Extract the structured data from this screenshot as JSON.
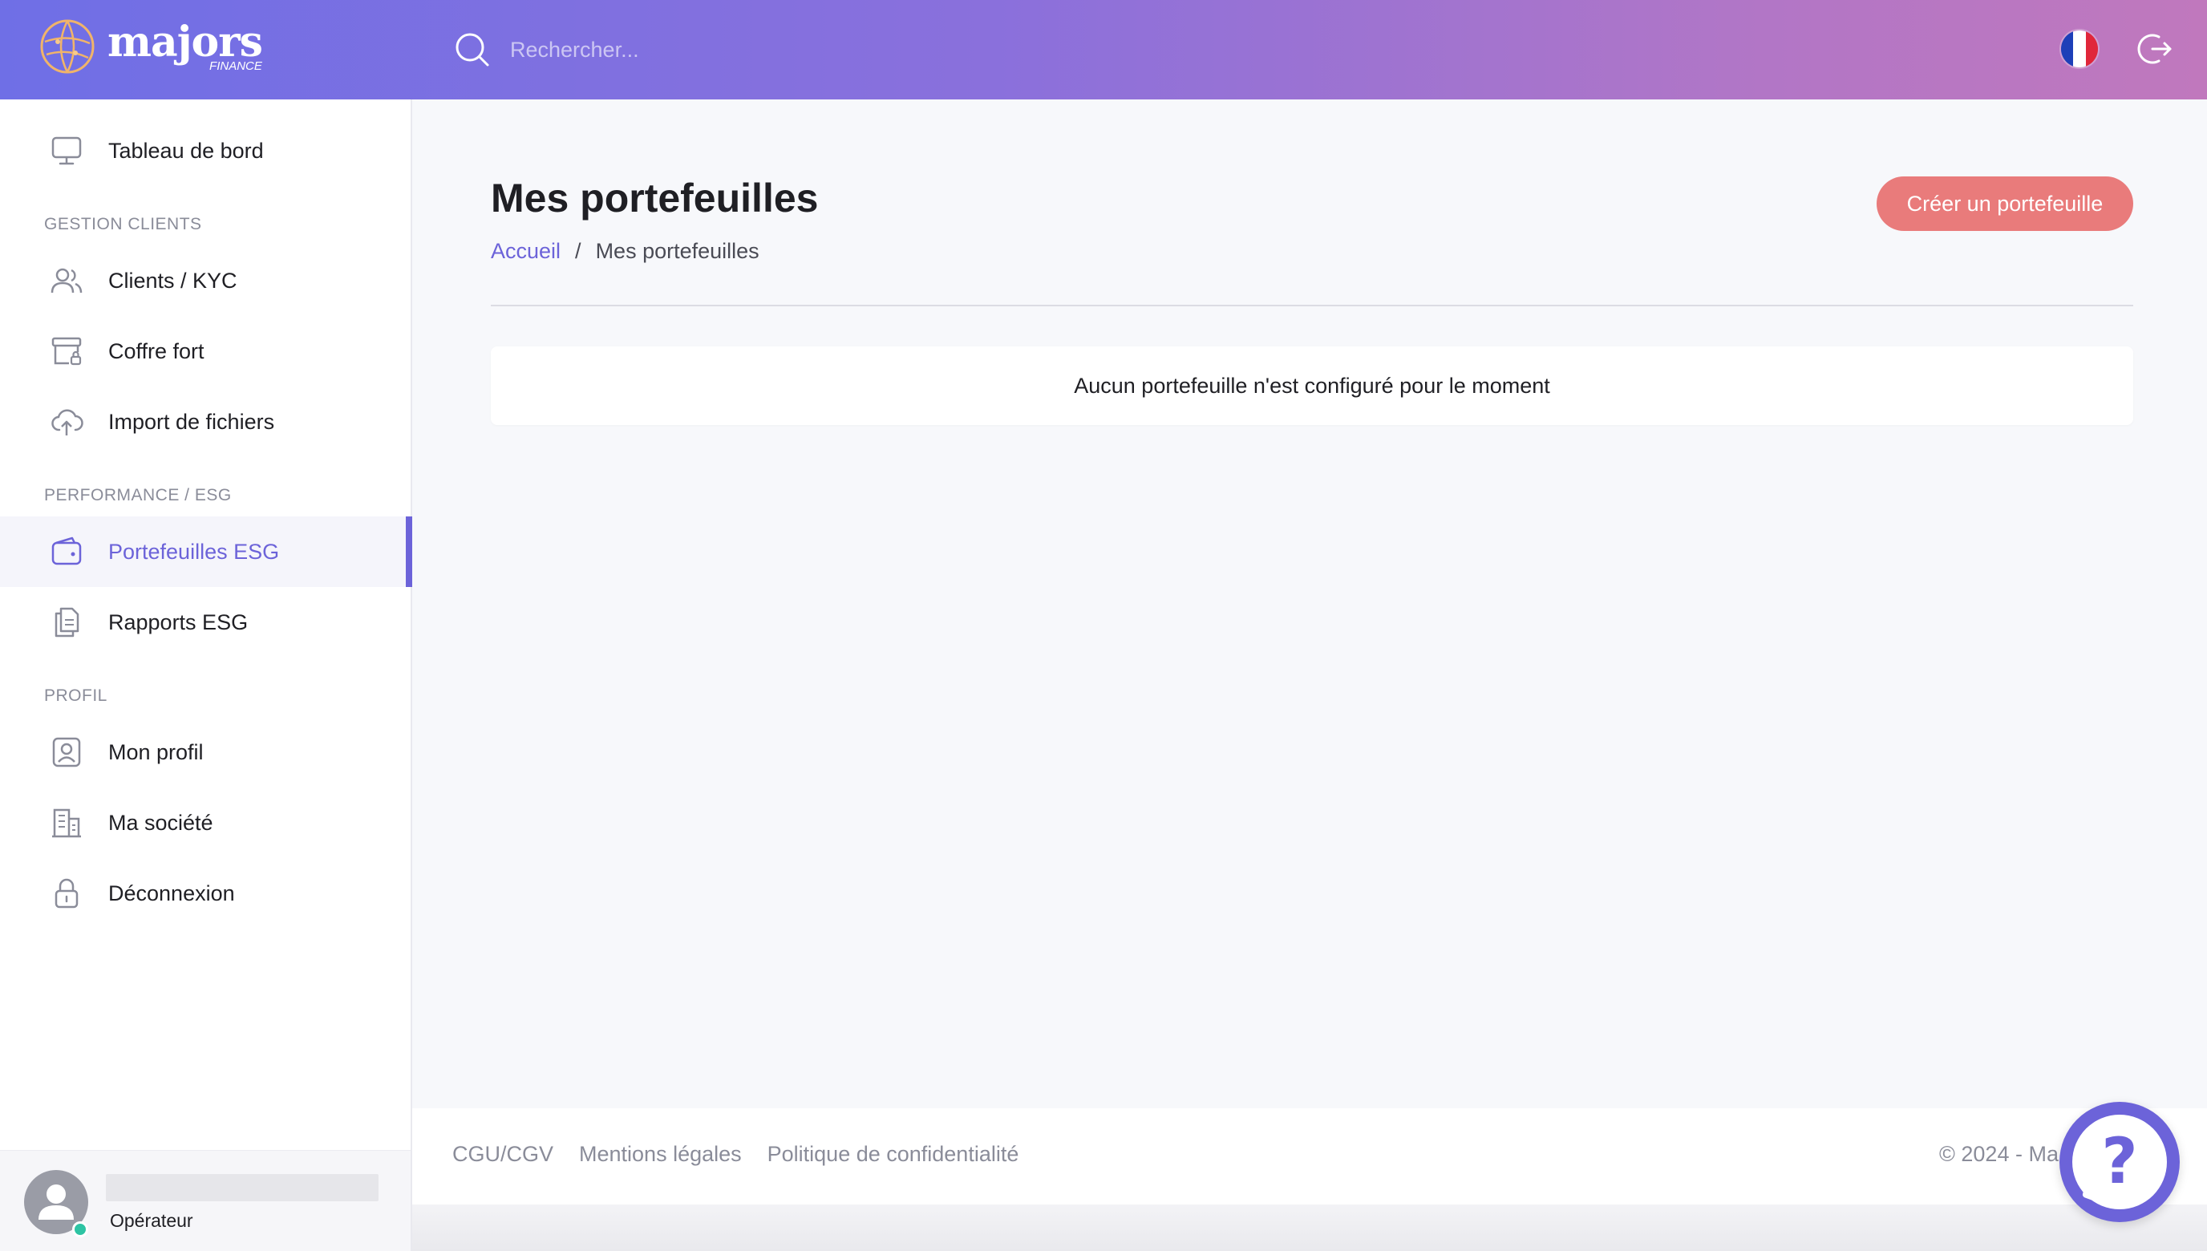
{
  "brand": {
    "name": "majors",
    "sub": "FINANCE",
    "accent": "#6c63d9",
    "danger": "#e97b7b"
  },
  "header": {
    "search_placeholder": "Rechercher...",
    "language": "fr"
  },
  "sidebar": {
    "items": [
      {
        "label": "Tableau de bord",
        "icon": "monitor-icon"
      },
      {
        "label": "Clients / KYC",
        "icon": "users-icon"
      },
      {
        "label": "Coffre fort",
        "icon": "archive-lock-icon"
      },
      {
        "label": "Import de fichiers",
        "icon": "cloud-upload-icon"
      },
      {
        "label": "Portefeuilles ESG",
        "icon": "wallet-icon",
        "active": true
      },
      {
        "label": "Rapports ESG",
        "icon": "documents-icon"
      },
      {
        "label": "Mon profil",
        "icon": "profile-icon"
      },
      {
        "label": "Ma société",
        "icon": "building-icon"
      },
      {
        "label": "Déconnexion",
        "icon": "lock-icon"
      }
    ],
    "sections": [
      "GESTION CLIENTS",
      "PERFORMANCE / ESG",
      "PROFIL"
    ],
    "user": {
      "role": "Opérateur",
      "status": "online"
    }
  },
  "main": {
    "title": "Mes portefeuilles",
    "breadcrumb": {
      "home": "Accueil",
      "separator": "/",
      "current": "Mes portefeuilles"
    },
    "create_button": "Créer un portefeuille",
    "empty_message": "Aucun portefeuille n'est configuré pour le moment"
  },
  "footer": {
    "links": [
      "CGU/CGV",
      "Mentions légales",
      "Politique de confidentialité"
    ],
    "copyright": "© 2024 - Ma"
  }
}
